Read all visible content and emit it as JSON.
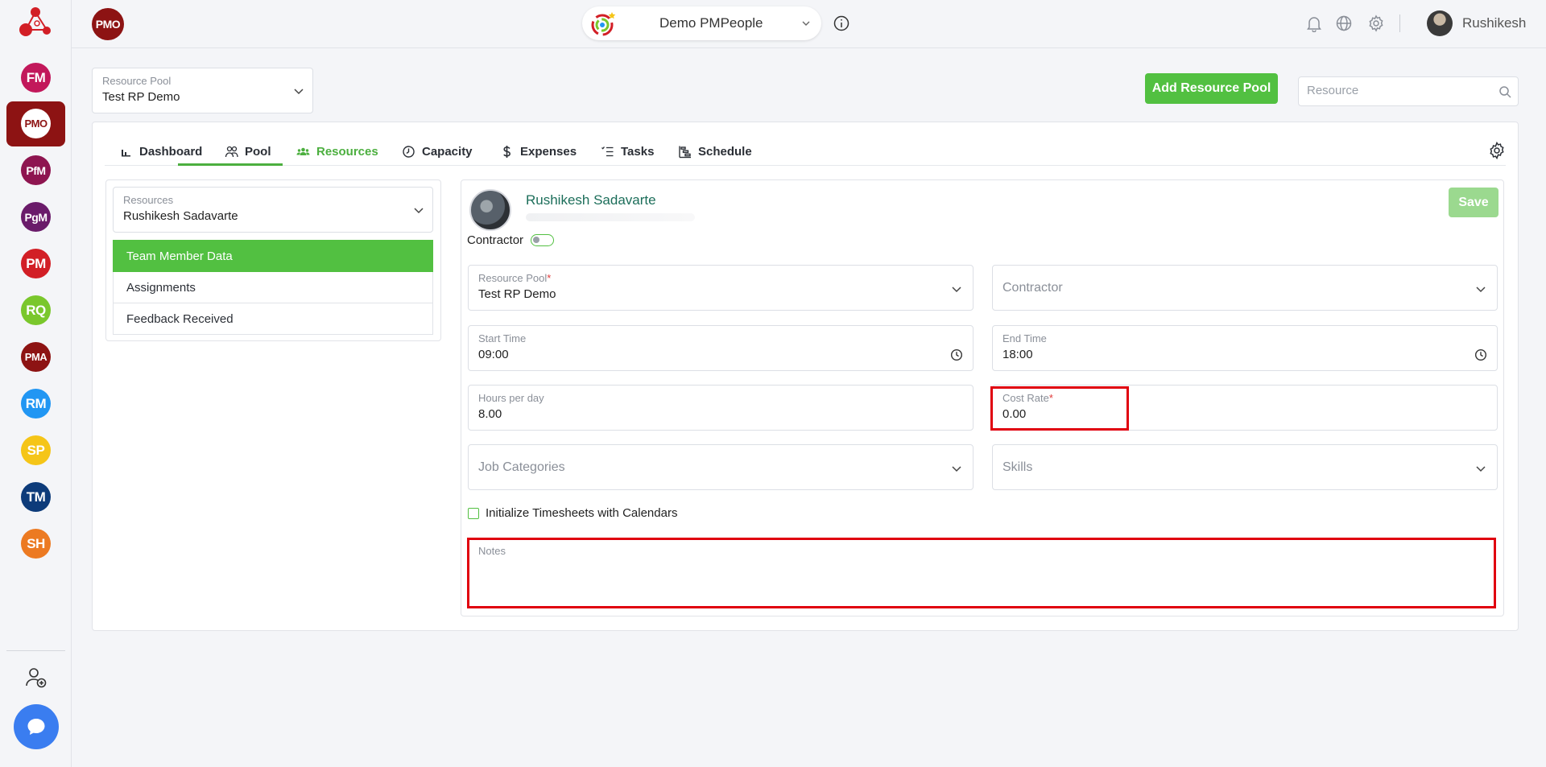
{
  "rail": {
    "items": [
      {
        "label": "FM",
        "color": "#c2185b"
      },
      {
        "label": "PMO",
        "color": "#8d1313",
        "active": true
      },
      {
        "label": "PfM",
        "color": "#8e1550"
      },
      {
        "label": "PgM",
        "color": "#6a1b6a"
      },
      {
        "label": "PM",
        "color": "#d21f26"
      },
      {
        "label": "RQ",
        "color": "#7ac72c"
      },
      {
        "label": "PMA",
        "color": "#8d1313"
      },
      {
        "label": "RM",
        "color": "#2196f3"
      },
      {
        "label": "SP",
        "color": "#f5c518"
      },
      {
        "label": "TM",
        "color": "#0d3b7a"
      },
      {
        "label": "SH",
        "color": "#ec7a22"
      }
    ]
  },
  "header": {
    "badge": "PMO",
    "workspace": "Demo PMPeople",
    "user_name": "Rushikesh"
  },
  "pool": {
    "label": "Resource Pool",
    "value": "Test RP Demo"
  },
  "actions": {
    "add_pool_label": "Add Resource Pool",
    "search_placeholder": "Resource"
  },
  "tabs": [
    {
      "label": "Dashboard",
      "icon": "bar-chart-icon"
    },
    {
      "label": "Pool",
      "icon": "people-icon"
    },
    {
      "label": "Resources",
      "icon": "team-icon",
      "active": true
    },
    {
      "label": "Capacity",
      "icon": "clock-icon"
    },
    {
      "label": "Expenses",
      "icon": "dollar-icon"
    },
    {
      "label": "Tasks",
      "icon": "checklist-icon"
    },
    {
      "label": "Schedule",
      "icon": "gantt-icon"
    }
  ],
  "left_panel": {
    "resources_label": "Resources",
    "resources_value": "Rushikesh Sadavarte",
    "menu": [
      "Team Member Data",
      "Assignments",
      "Feedback Received"
    ]
  },
  "profile": {
    "name": "Rushikesh Sadavarte",
    "save_label": "Save",
    "contractor_label": "Contractor"
  },
  "form": {
    "resource_pool": {
      "label": "Resource Pool",
      "value": "Test RP Demo"
    },
    "contractor": {
      "placeholder": "Contractor"
    },
    "start_time": {
      "label": "Start Time",
      "value": "09:00"
    },
    "end_time": {
      "label": "End Time",
      "value": "18:00"
    },
    "hours_per_day": {
      "label": "Hours per day",
      "value": "8.00"
    },
    "cost_rate": {
      "label": "Cost Rate",
      "value": "0.00"
    },
    "job_categories": {
      "placeholder": "Job Categories"
    },
    "skills": {
      "placeholder": "Skills"
    },
    "init_timesheets_label": "Initialize Timesheets with Calendars",
    "notes_label": "Notes",
    "required_mark": "*"
  },
  "colors": {
    "accent_green": "#52c041",
    "highlight_red": "#e0000f",
    "brand_red": "#8d1313"
  }
}
